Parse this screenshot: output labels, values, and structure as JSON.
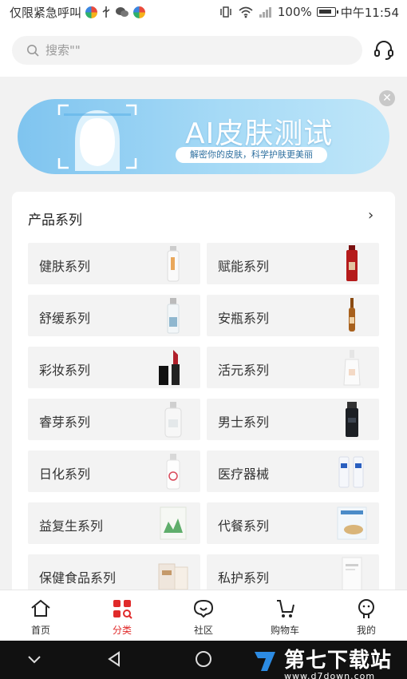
{
  "status_bar": {
    "carrier": "仅限紧急呼叫",
    "battery": "100%",
    "time": "中午11:54"
  },
  "search": {
    "placeholder": "搜索\"\""
  },
  "banner": {
    "title": "AI皮肤测试",
    "subtitle": "解密你的皮肤，科学护肤更美丽"
  },
  "section": {
    "title": "产品系列",
    "more": "›"
  },
  "categories": [
    {
      "label": "健肤系列",
      "icon": "serum-bottle-icon"
    },
    {
      "label": "赋能系列",
      "icon": "red-bottle-icon"
    },
    {
      "label": "舒缓系列",
      "icon": "spray-bottle-icon"
    },
    {
      "label": "安瓶系列",
      "icon": "ampoule-icon"
    },
    {
      "label": "彩妆系列",
      "icon": "lipstick-icon"
    },
    {
      "label": "活元系列",
      "icon": "dropper-bottle-icon"
    },
    {
      "label": "睿芽系列",
      "icon": "pump-bottle-icon"
    },
    {
      "label": "男士系列",
      "icon": "black-bottle-icon"
    },
    {
      "label": "日化系列",
      "icon": "cleanser-bottle-icon"
    },
    {
      "label": "医疗器械",
      "icon": "medical-bottles-icon"
    },
    {
      "label": "益复生系列",
      "icon": "supplement-box-icon"
    },
    {
      "label": "代餐系列",
      "icon": "meal-box-icon"
    },
    {
      "label": "保健食品系列",
      "icon": "health-food-icon"
    },
    {
      "label": "私护系列",
      "icon": "care-box-icon"
    }
  ],
  "tabs": [
    {
      "label": "首页",
      "icon": "home-icon"
    },
    {
      "label": "分类",
      "icon": "category-icon"
    },
    {
      "label": "社区",
      "icon": "community-icon"
    },
    {
      "label": "购物车",
      "icon": "cart-icon"
    },
    {
      "label": "我的",
      "icon": "profile-icon"
    }
  ],
  "active_tab": "分类",
  "watermark": {
    "text": "第七下载站",
    "url": "www.d7down.com"
  },
  "colors": {
    "accent": "#e02a2a",
    "banner": "#8fcdf2"
  }
}
